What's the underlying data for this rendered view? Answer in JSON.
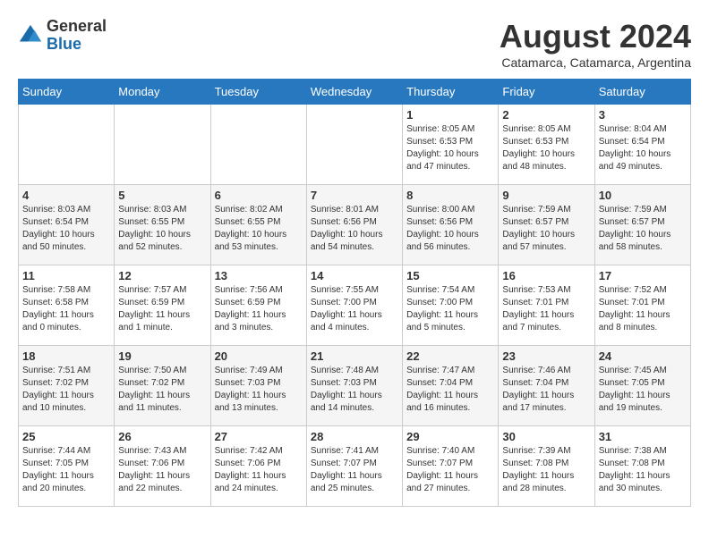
{
  "header": {
    "logo_general": "General",
    "logo_blue": "Blue",
    "month_year": "August 2024",
    "location": "Catamarca, Catamarca, Argentina"
  },
  "days_of_week": [
    "Sunday",
    "Monday",
    "Tuesday",
    "Wednesday",
    "Thursday",
    "Friday",
    "Saturday"
  ],
  "weeks": [
    [
      {
        "day": "",
        "info": ""
      },
      {
        "day": "",
        "info": ""
      },
      {
        "day": "",
        "info": ""
      },
      {
        "day": "",
        "info": ""
      },
      {
        "day": "1",
        "info": "Sunrise: 8:05 AM\nSunset: 6:53 PM\nDaylight: 10 hours\nand 47 minutes."
      },
      {
        "day": "2",
        "info": "Sunrise: 8:05 AM\nSunset: 6:53 PM\nDaylight: 10 hours\nand 48 minutes."
      },
      {
        "day": "3",
        "info": "Sunrise: 8:04 AM\nSunset: 6:54 PM\nDaylight: 10 hours\nand 49 minutes."
      }
    ],
    [
      {
        "day": "4",
        "info": "Sunrise: 8:03 AM\nSunset: 6:54 PM\nDaylight: 10 hours\nand 50 minutes."
      },
      {
        "day": "5",
        "info": "Sunrise: 8:03 AM\nSunset: 6:55 PM\nDaylight: 10 hours\nand 52 minutes."
      },
      {
        "day": "6",
        "info": "Sunrise: 8:02 AM\nSunset: 6:55 PM\nDaylight: 10 hours\nand 53 minutes."
      },
      {
        "day": "7",
        "info": "Sunrise: 8:01 AM\nSunset: 6:56 PM\nDaylight: 10 hours\nand 54 minutes."
      },
      {
        "day": "8",
        "info": "Sunrise: 8:00 AM\nSunset: 6:56 PM\nDaylight: 10 hours\nand 56 minutes."
      },
      {
        "day": "9",
        "info": "Sunrise: 7:59 AM\nSunset: 6:57 PM\nDaylight: 10 hours\nand 57 minutes."
      },
      {
        "day": "10",
        "info": "Sunrise: 7:59 AM\nSunset: 6:57 PM\nDaylight: 10 hours\nand 58 minutes."
      }
    ],
    [
      {
        "day": "11",
        "info": "Sunrise: 7:58 AM\nSunset: 6:58 PM\nDaylight: 11 hours\nand 0 minutes."
      },
      {
        "day": "12",
        "info": "Sunrise: 7:57 AM\nSunset: 6:59 PM\nDaylight: 11 hours\nand 1 minute."
      },
      {
        "day": "13",
        "info": "Sunrise: 7:56 AM\nSunset: 6:59 PM\nDaylight: 11 hours\nand 3 minutes."
      },
      {
        "day": "14",
        "info": "Sunrise: 7:55 AM\nSunset: 7:00 PM\nDaylight: 11 hours\nand 4 minutes."
      },
      {
        "day": "15",
        "info": "Sunrise: 7:54 AM\nSunset: 7:00 PM\nDaylight: 11 hours\nand 5 minutes."
      },
      {
        "day": "16",
        "info": "Sunrise: 7:53 AM\nSunset: 7:01 PM\nDaylight: 11 hours\nand 7 minutes."
      },
      {
        "day": "17",
        "info": "Sunrise: 7:52 AM\nSunset: 7:01 PM\nDaylight: 11 hours\nand 8 minutes."
      }
    ],
    [
      {
        "day": "18",
        "info": "Sunrise: 7:51 AM\nSunset: 7:02 PM\nDaylight: 11 hours\nand 10 minutes."
      },
      {
        "day": "19",
        "info": "Sunrise: 7:50 AM\nSunset: 7:02 PM\nDaylight: 11 hours\nand 11 minutes."
      },
      {
        "day": "20",
        "info": "Sunrise: 7:49 AM\nSunset: 7:03 PM\nDaylight: 11 hours\nand 13 minutes."
      },
      {
        "day": "21",
        "info": "Sunrise: 7:48 AM\nSunset: 7:03 PM\nDaylight: 11 hours\nand 14 minutes."
      },
      {
        "day": "22",
        "info": "Sunrise: 7:47 AM\nSunset: 7:04 PM\nDaylight: 11 hours\nand 16 minutes."
      },
      {
        "day": "23",
        "info": "Sunrise: 7:46 AM\nSunset: 7:04 PM\nDaylight: 11 hours\nand 17 minutes."
      },
      {
        "day": "24",
        "info": "Sunrise: 7:45 AM\nSunset: 7:05 PM\nDaylight: 11 hours\nand 19 minutes."
      }
    ],
    [
      {
        "day": "25",
        "info": "Sunrise: 7:44 AM\nSunset: 7:05 PM\nDaylight: 11 hours\nand 20 minutes."
      },
      {
        "day": "26",
        "info": "Sunrise: 7:43 AM\nSunset: 7:06 PM\nDaylight: 11 hours\nand 22 minutes."
      },
      {
        "day": "27",
        "info": "Sunrise: 7:42 AM\nSunset: 7:06 PM\nDaylight: 11 hours\nand 24 minutes."
      },
      {
        "day": "28",
        "info": "Sunrise: 7:41 AM\nSunset: 7:07 PM\nDaylight: 11 hours\nand 25 minutes."
      },
      {
        "day": "29",
        "info": "Sunrise: 7:40 AM\nSunset: 7:07 PM\nDaylight: 11 hours\nand 27 minutes."
      },
      {
        "day": "30",
        "info": "Sunrise: 7:39 AM\nSunset: 7:08 PM\nDaylight: 11 hours\nand 28 minutes."
      },
      {
        "day": "31",
        "info": "Sunrise: 7:38 AM\nSunset: 7:08 PM\nDaylight: 11 hours\nand 30 minutes."
      }
    ]
  ]
}
